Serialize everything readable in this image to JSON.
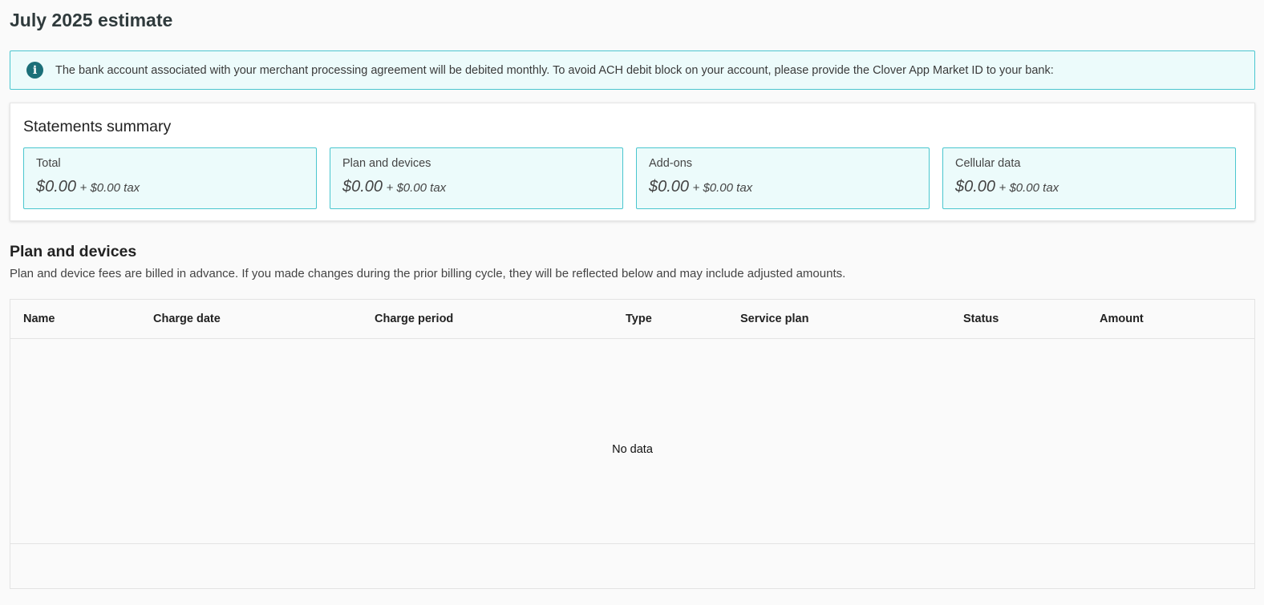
{
  "header": {
    "title": "July 2025 estimate"
  },
  "banner": {
    "icon": "info-icon",
    "text": "The bank account associated with your merchant processing agreement will be debited monthly. To avoid ACH debit block on your account, please provide the Clover App Market ID to your bank:"
  },
  "summary": {
    "title": "Statements summary",
    "tiles": [
      {
        "label": "Total",
        "amount": "$0.00",
        "tax": "+ $0.00 tax"
      },
      {
        "label": "Plan and devices",
        "amount": "$0.00",
        "tax": "+ $0.00 tax"
      },
      {
        "label": "Add-ons",
        "amount": "$0.00",
        "tax": "+ $0.00 tax"
      },
      {
        "label": "Cellular data",
        "amount": "$0.00",
        "tax": "+ $0.00 tax"
      }
    ]
  },
  "plan_devices": {
    "title": "Plan and devices",
    "description": "Plan and device fees are billed in advance. If you made changes during the prior billing cycle, they will be reflected below and may include adjusted amounts.",
    "table": {
      "columns": [
        "Name",
        "Charge date",
        "Charge period",
        "Type",
        "Service plan",
        "Status",
        "Amount"
      ],
      "empty_text": "No data"
    }
  },
  "colors": {
    "accent_border": "#4ac6cf",
    "accent_bg": "#ecfbfb",
    "info_icon": "#1b6f78"
  }
}
